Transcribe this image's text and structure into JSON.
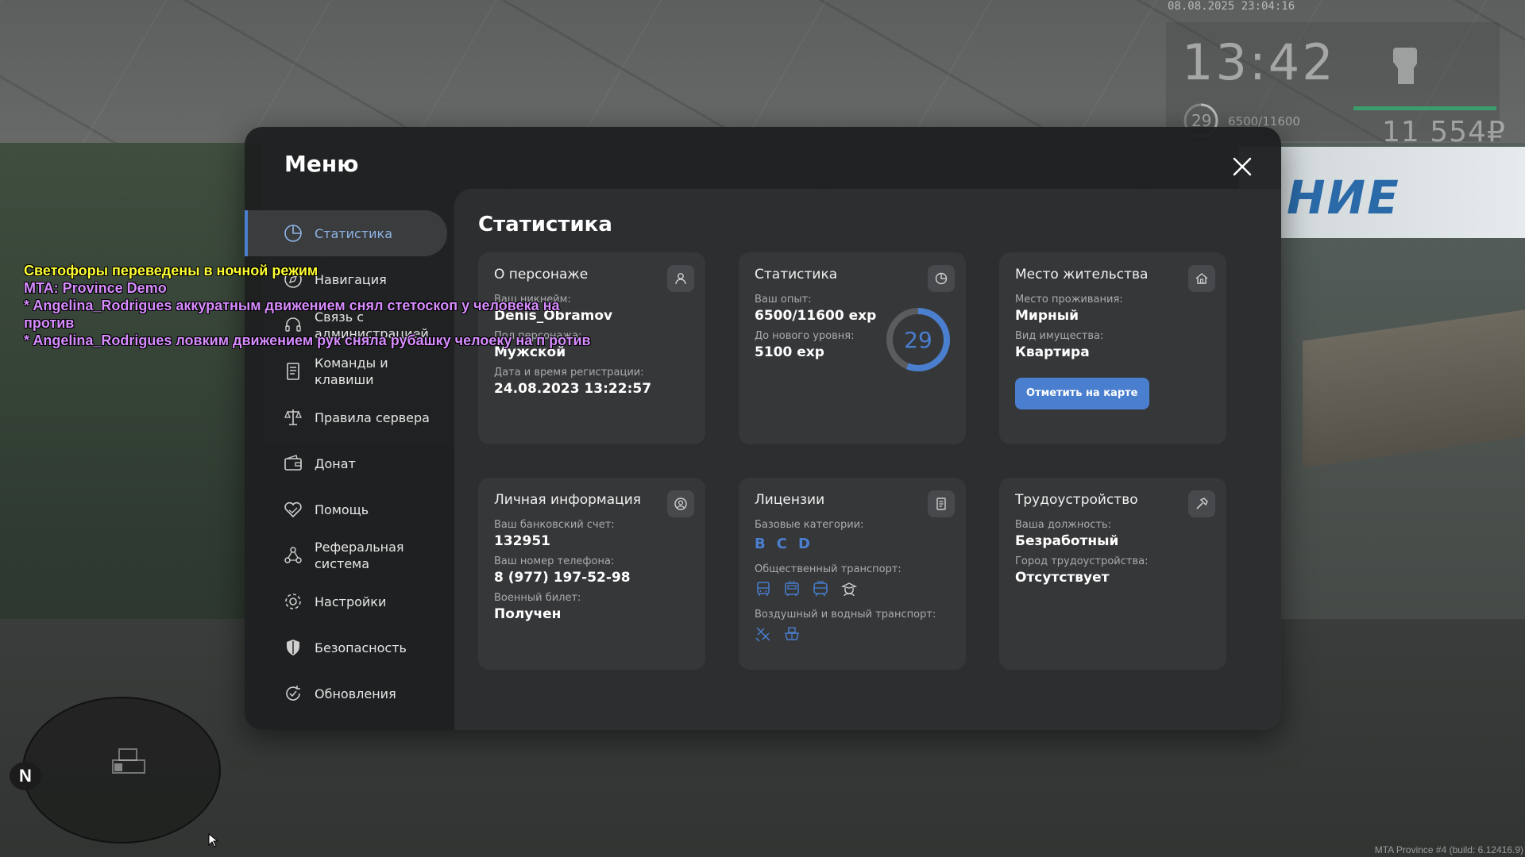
{
  "hud": {
    "date": "08.08.2025 23:04:16",
    "time": "13:42",
    "level": "29",
    "exp": "6500/11600",
    "money": "11 554₽"
  },
  "chat": [
    {
      "text": "Светофоры переведены в ночной режим",
      "color": "yellow"
    },
    {
      "text": "MTA: Province Demo",
      "color": "purple"
    },
    {
      "text": "* Angelina_Rodrigues аккуратным движением снял стетоскоп у человека на против",
      "color": "purple"
    },
    {
      "text": "* Angelina_Rodrigues ловким движением рук сняла рубашку челоеку на п ротив",
      "color": "purple"
    }
  ],
  "world": {
    "sign_text": "НИЕ",
    "minimap_north": "N",
    "build": "MTA Province #4 (build: 6.12416.9)"
  },
  "menu": {
    "title": "Меню",
    "sidebar": [
      {
        "label": "Статистика",
        "icon": "pie-chart-icon",
        "active": true
      },
      {
        "label": "Навигация",
        "icon": "compass-icon",
        "active": false
      },
      {
        "label": "Связь с администрацией",
        "icon": "headset-icon",
        "active": false
      },
      {
        "label": "Команды и клавиши",
        "icon": "document-icon",
        "active": false
      },
      {
        "label": "Правила сервера",
        "icon": "scales-icon",
        "active": false
      },
      {
        "label": "Донат",
        "icon": "wallet-icon",
        "active": false
      },
      {
        "label": "Помощь",
        "icon": "handshake-heart-icon",
        "active": false
      },
      {
        "label": "Реферальная система",
        "icon": "people-network-icon",
        "active": false
      },
      {
        "label": "Настройки",
        "icon": "gear-icon",
        "active": false
      },
      {
        "label": "Безопасность",
        "icon": "shield-icon",
        "active": false
      },
      {
        "label": "Обновления",
        "icon": "refresh-check-icon",
        "active": false
      }
    ],
    "content_title": "Статистика",
    "cards": {
      "character": {
        "title": "О персонаже",
        "icon": "user-icon",
        "nick_label": "Ваш никнейм:",
        "nick_value": "Denis_Obramov",
        "gender_label": "Пол персонажа:",
        "gender_value": "Мужской",
        "reg_label": "Дата и время регистрации:",
        "reg_value": "24.08.2023 13:22:57"
      },
      "stats": {
        "title": "Статистика",
        "icon": "pie-chart-icon",
        "exp_label": "Ваш опыт:",
        "exp_value": "6500/11600 exp",
        "next_label": "До нового уровня:",
        "next_value": "5100 exp",
        "level": "29",
        "progress": 0.56
      },
      "residence": {
        "title": "Место жительства",
        "icon": "house-icon",
        "place_label": "Место проживания:",
        "place_value": "Мирный",
        "property_label": "Вид имущества:",
        "property_value": "Квартира",
        "map_button": "Отметить на карте"
      },
      "personal": {
        "title": "Личная информация",
        "icon": "user-circle-icon",
        "bank_label": "Ваш банковский счет:",
        "bank_value": "132951",
        "phone_label": "Ваш номер телефона:",
        "phone_value": "8 (977) 197-52-98",
        "military_label": "Военный билет:",
        "military_value": "Получен"
      },
      "licenses": {
        "title": "Лицензии",
        "icon": "id-card-icon",
        "base_label": "Базовые категории:",
        "base_categories": [
          "B",
          "C",
          "D"
        ],
        "public_label": "Общественный транспорт:",
        "public_icons": [
          "bus-icon",
          "trolleybus-icon",
          "tram-icon",
          "taxi-driver-icon"
        ],
        "air_label": "Воздушный и водный транспорт:",
        "air_icons": [
          "plane-icon",
          "boat-icon"
        ]
      },
      "employment": {
        "title": "Трудоустройство",
        "icon": "hammer-icon",
        "position_label": "Ваша должность:",
        "position_value": "Безработный",
        "city_label": "Город трудоустройства:",
        "city_value": "Отсутствует"
      }
    }
  },
  "colors": {
    "accent": "#4a7fd0",
    "chat_yellow": "#ffff33",
    "chat_purple": "#d78cff"
  }
}
